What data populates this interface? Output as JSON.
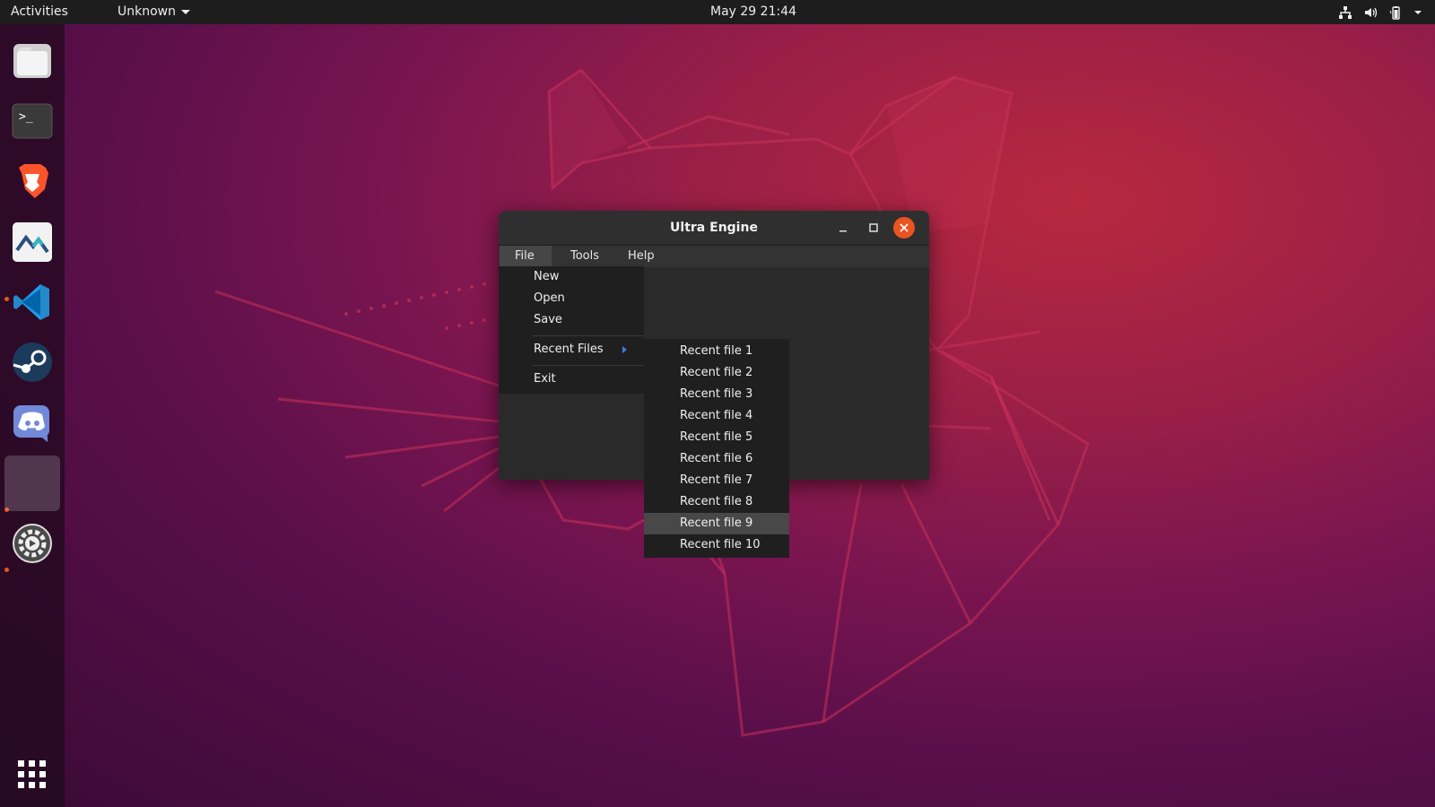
{
  "topbar": {
    "activities_label": "Activities",
    "app_menu_label": "Unknown",
    "clock": "May 29  21:44"
  },
  "dock": {
    "items": [
      {
        "icon": "files-icon"
      },
      {
        "icon": "terminal-icon"
      },
      {
        "icon": "brave-browser-icon"
      },
      {
        "icon": "ultra-engine-icon"
      },
      {
        "icon": "vscode-icon"
      },
      {
        "icon": "steam-icon"
      },
      {
        "icon": "discord-icon"
      },
      {
        "icon": "running-app-icon"
      },
      {
        "icon": "settings-icon"
      }
    ],
    "show_apps_icon": "app-grid-icon"
  },
  "window": {
    "title": "Ultra Engine",
    "menubar": {
      "file": "File",
      "tools": "Tools",
      "help": "Help"
    },
    "file_menu": {
      "new": "New",
      "open": "Open",
      "save": "Save",
      "recent_files": "Recent Files",
      "exit": "Exit"
    },
    "recent_files": [
      "Recent file 1",
      "Recent file 2",
      "Recent file 3",
      "Recent file 4",
      "Recent file 5",
      "Recent file 6",
      "Recent file 7",
      "Recent file 8",
      "Recent file 9",
      "Recent file 10"
    ],
    "highlighted_recent": "Recent file 9"
  },
  "colors": {
    "accent": "#e95420",
    "submenu_arrow": "#3d7be0"
  }
}
